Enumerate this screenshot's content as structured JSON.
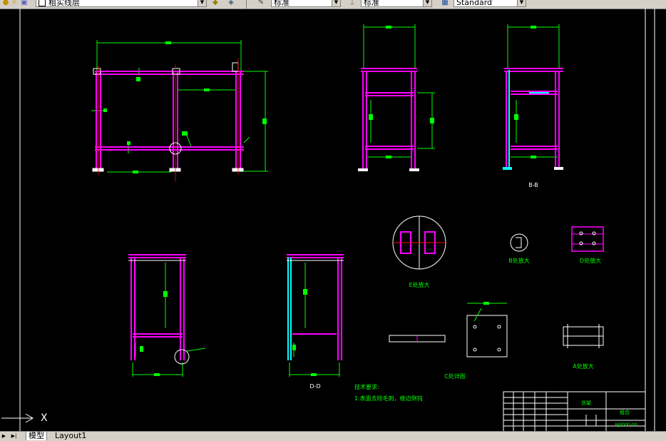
{
  "toolbar": {
    "layer_name": "粗实线层",
    "dimstyle_name": "标准",
    "textstyle_name": "标准",
    "tablestyle_name": "Standard"
  },
  "drawing": {
    "section_bb": "B-B",
    "section_dd": "D-D",
    "detail_e": "E处放大",
    "detail_b": "B处放大",
    "detail_d": "D处放大",
    "detail_c": "C处详图",
    "detail_a": "A处放大",
    "tech_title": "技术要求:",
    "tech_note1": "1.表面去除毛刺，棱边倒钝",
    "tb_name": "货架",
    "tb_material": "组合",
    "tb_drawing_no": "HJ0000-00",
    "ucs_x": "X"
  },
  "tabs": {
    "model": "模型",
    "layout1": "Layout1"
  },
  "colors": {
    "frame": "#ff00ff",
    "dimension": "#00ff00",
    "accent": "#00ffff",
    "border": "#ffffff",
    "center": "#ff0000"
  }
}
